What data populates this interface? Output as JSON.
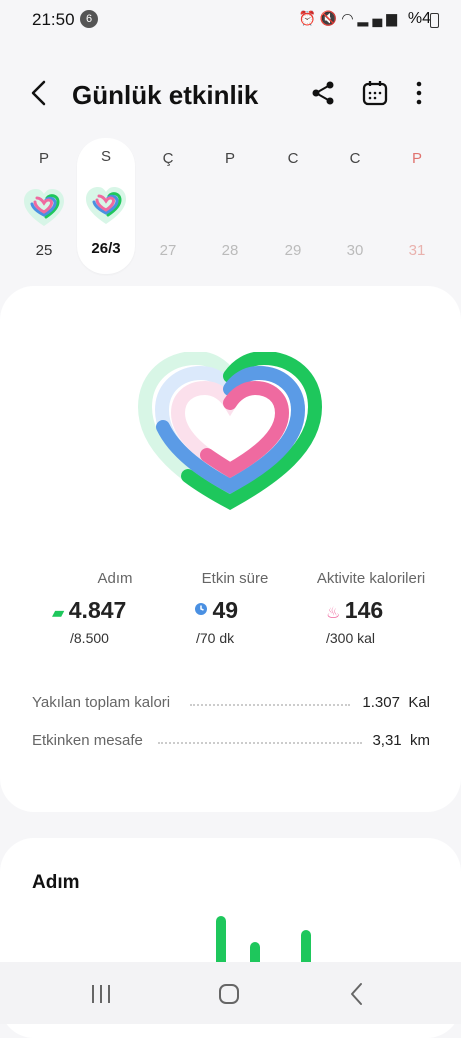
{
  "status": {
    "time": "21:50",
    "notif_count": "6",
    "battery": "%4"
  },
  "header": {
    "title": "Günlük etkinlik"
  },
  "week": [
    {
      "letter": "P",
      "num": "25"
    },
    {
      "letter": "S",
      "num": "26/3"
    },
    {
      "letter": "Ç",
      "num": "27"
    },
    {
      "letter": "P",
      "num": "28"
    },
    {
      "letter": "C",
      "num": "29"
    },
    {
      "letter": "C",
      "num": "30"
    },
    {
      "letter": "P",
      "num": "31"
    }
  ],
  "stats": {
    "steps": {
      "label": "Adım",
      "value": "4.847",
      "goal": "/8.500",
      "progress": 0.57
    },
    "active": {
      "label": "Etkin süre",
      "value": "49",
      "goal": "/70 dk",
      "progress": 0.7
    },
    "calories": {
      "label": "Aktivite kalorileri",
      "value": "146",
      "goal": "/300 kal",
      "progress": 0.49
    }
  },
  "details": {
    "total_cal_label": "Yakılan toplam kalori",
    "total_cal_value": "1.307",
    "total_cal_unit": "Kal",
    "distance_label": "Etkinken mesafe",
    "distance_value": "3,31",
    "distance_unit": "km"
  },
  "steps_card": {
    "title": "Adım"
  },
  "colors": {
    "steps": "#1ec75c",
    "active": "#4a90e2",
    "calories": "#ef6aa0",
    "sunday": "#e0736f"
  }
}
